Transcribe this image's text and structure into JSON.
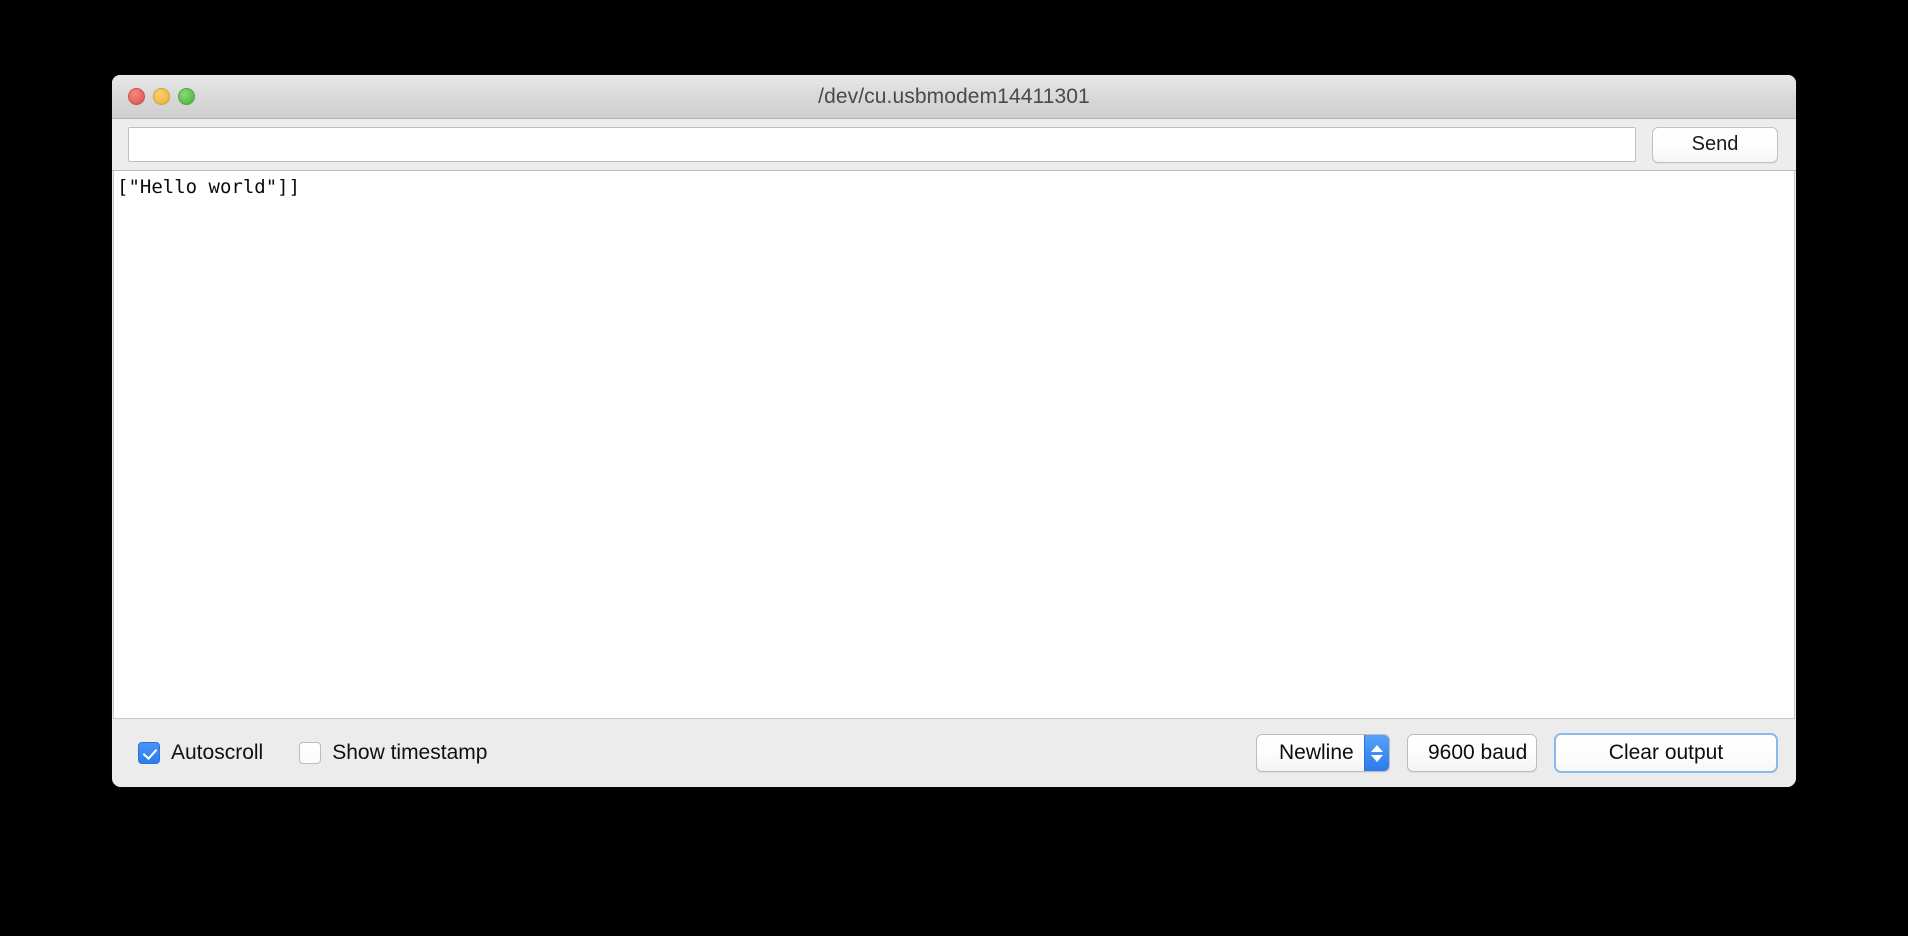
{
  "window": {
    "title": "/dev/cu.usbmodem14411301",
    "traffic_lights": {
      "close": "close-button",
      "minimize": "minimize-button",
      "zoom": "zoom-button"
    }
  },
  "send_bar": {
    "input_value": "",
    "input_placeholder": "",
    "send_label": "Send"
  },
  "output": {
    "lines": [
      "[\"Hello world\"]]"
    ]
  },
  "bottom_bar": {
    "autoscroll": {
      "label": "Autoscroll",
      "checked": true
    },
    "show_timestamp": {
      "label": "Show timestamp",
      "checked": false
    },
    "line_ending": {
      "value": "Newline"
    },
    "baud_rate": {
      "value": "9600 baud"
    },
    "clear_label": "Clear output"
  },
  "colors": {
    "accent_blue": "#2d7cec",
    "focus_ring": "#8bb9ee",
    "light_red": "#e8655a",
    "light_yellow": "#f4bd4a",
    "light_green": "#5fc24f",
    "window_chrome": "#ececec",
    "desktop": "#000000"
  }
}
